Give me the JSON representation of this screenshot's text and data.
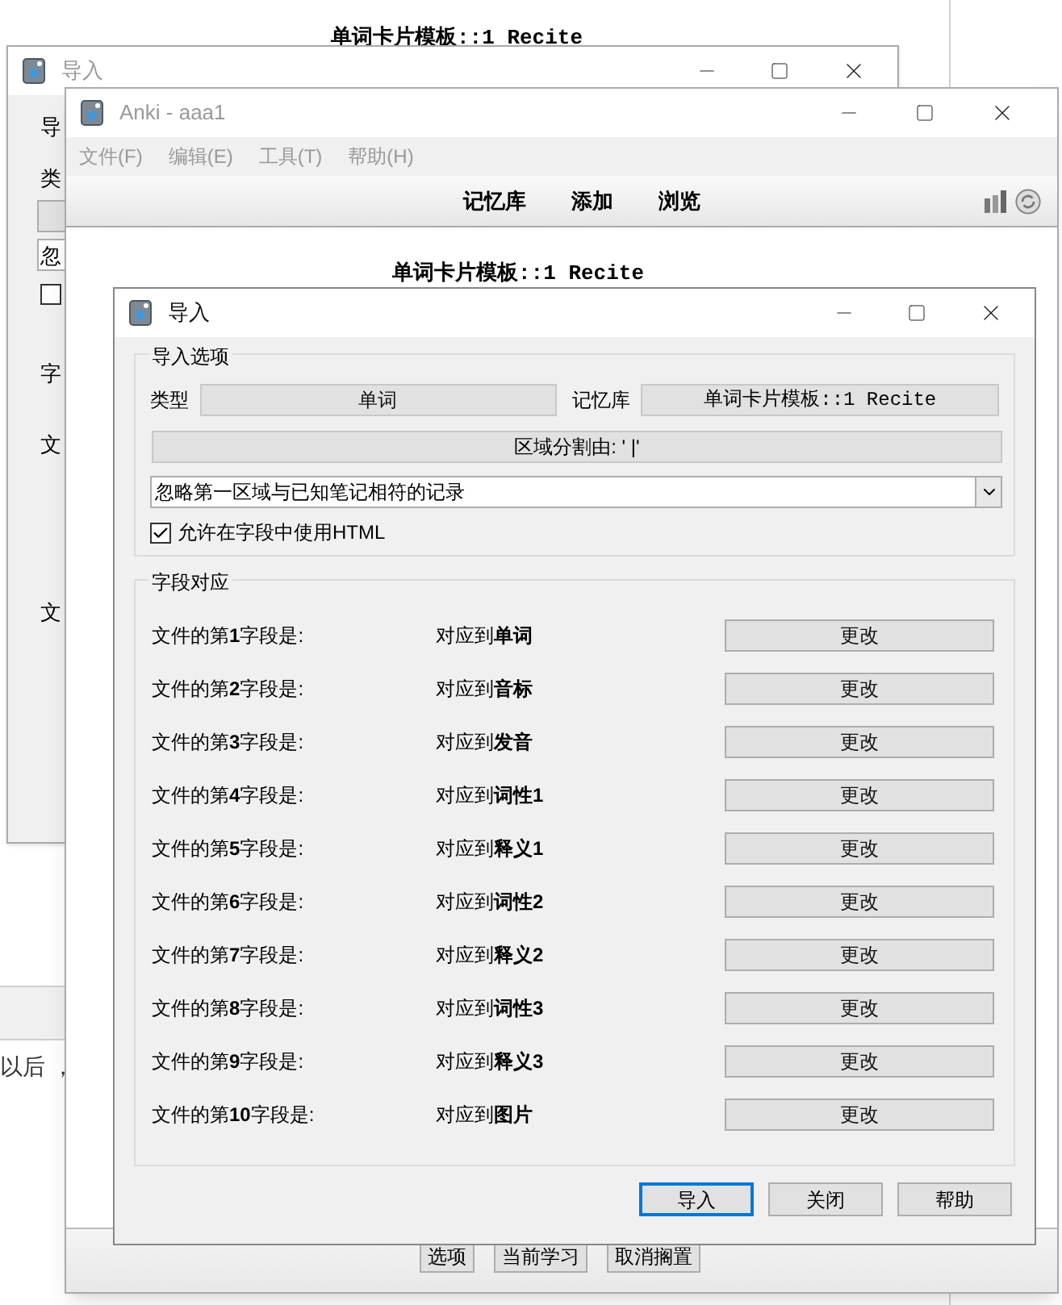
{
  "back_window": {
    "heading": "单词卡片模板::1 Recite",
    "cut_text": "以后 ，"
  },
  "back_import_window": {
    "title": "导入",
    "cut_labels": [
      "导",
      "类",
      "忽",
      "字",
      "文",
      "文"
    ],
    "checkbox_checked": false
  },
  "main_window": {
    "title": "Anki - aaa1",
    "menu": [
      {
        "label": "文件(F)",
        "disabled": true
      },
      {
        "label": "编辑(E)",
        "disabled": true
      },
      {
        "label": "工具(T)",
        "disabled": true
      },
      {
        "label": "帮助(H)",
        "disabled": true
      }
    ],
    "toolbar": [
      "记忆库",
      "添加",
      "浏览"
    ],
    "heading": "单词卡片模板::1 Recite",
    "bottom_buttons": [
      "选项",
      "当前学习",
      "取消搁置"
    ]
  },
  "import_dialog": {
    "title": "导入",
    "options_group": {
      "title": "导入选项",
      "type_label": "类型",
      "type_value": "单词",
      "deck_label": "记忆库",
      "deck_value": "单词卡片模板::1 Recite",
      "separator": "区域分割由: ' |'",
      "duplicate_mode": "忽略第一区域与已知笔记相符的记录",
      "allow_html": {
        "label": "允许在字段中使用HTML",
        "checked": true
      }
    },
    "fields_group": {
      "title": "字段对应",
      "rows": [
        {
          "field": "文件的第**1**字段是:",
          "target": "对应到**单词**",
          "button": "更改"
        },
        {
          "field": "文件的第**2**字段是:",
          "target": "对应到**音标**",
          "button": "更改"
        },
        {
          "field": "文件的第**3**字段是:",
          "target": "对应到**发音**",
          "button": "更改"
        },
        {
          "field": "文件的第**4**字段是:",
          "target": "对应到**词性1**",
          "button": "更改"
        },
        {
          "field": "文件的第**5**字段是:",
          "target": "对应到**释义1**",
          "button": "更改"
        },
        {
          "field": "文件的第**6**字段是:",
          "target": "对应到**词性2**",
          "button": "更改"
        },
        {
          "field": "文件的第**7**字段是:",
          "target": "对应到**释义2**",
          "button": "更改"
        },
        {
          "field": "文件的第**8**字段是:",
          "target": "对应到**词性3**",
          "button": "更改"
        },
        {
          "field": "文件的第**9**字段是:",
          "target": "对应到**释义3**",
          "button": "更改"
        },
        {
          "field": "文件的第**10**字段是:",
          "target": "对应到**图片**",
          "button": "更改"
        }
      ]
    },
    "buttons": [
      {
        "label": "导入",
        "default": true
      },
      {
        "label": "关闭",
        "default": false
      },
      {
        "label": "帮助",
        "default": false
      }
    ]
  }
}
